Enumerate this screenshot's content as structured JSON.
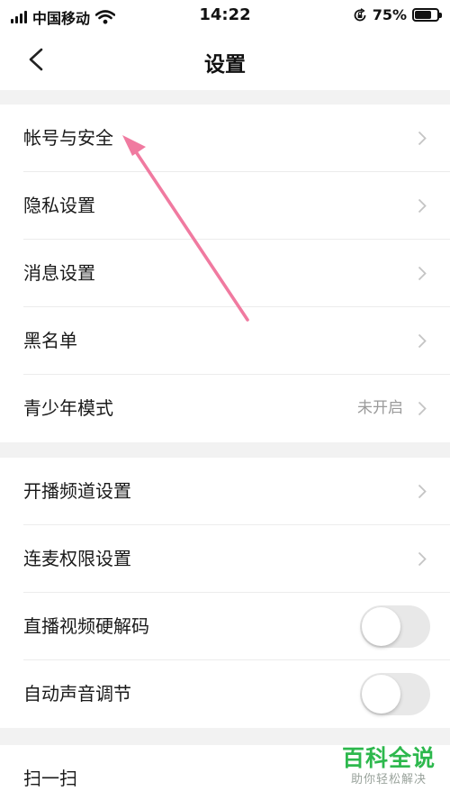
{
  "status_bar": {
    "carrier": "中国移动",
    "time": "14:22",
    "battery_pct": "75%",
    "battery_level": 0.75,
    "icons": [
      "signal-icon",
      "wifi-icon",
      "orientation-lock-icon",
      "battery-icon"
    ]
  },
  "nav": {
    "title": "设置",
    "back_icon": "chevron-left-icon"
  },
  "groups": [
    {
      "items": [
        {
          "label": "帐号与安全",
          "control": "chevron"
        },
        {
          "label": "隐私设置",
          "control": "chevron"
        },
        {
          "label": "消息设置",
          "control": "chevron"
        },
        {
          "label": "黑名单",
          "control": "chevron"
        },
        {
          "label": "青少年模式",
          "value": "未开启",
          "control": "chevron"
        }
      ]
    },
    {
      "items": [
        {
          "label": "开播频道设置",
          "control": "chevron"
        },
        {
          "label": "连麦权限设置",
          "control": "chevron"
        },
        {
          "label": "直播视频硬解码",
          "control": "toggle",
          "on": false
        },
        {
          "label": "自动声音调节",
          "control": "toggle",
          "on": false
        }
      ]
    },
    {
      "items": [
        {
          "label": "扫一扫",
          "control": "chevron"
        }
      ]
    }
  ],
  "annotation": {
    "type": "arrow",
    "color": "#f07aa0",
    "points_to": "帐号与安全"
  },
  "watermark": {
    "title": "百科全说",
    "subtitle": "助你轻松解决",
    "color": "#2db84d"
  },
  "colors": {
    "background": "#f2f2f2",
    "surface": "#ffffff",
    "divider": "#ececec",
    "secondary_text": "#9a9a9a"
  }
}
